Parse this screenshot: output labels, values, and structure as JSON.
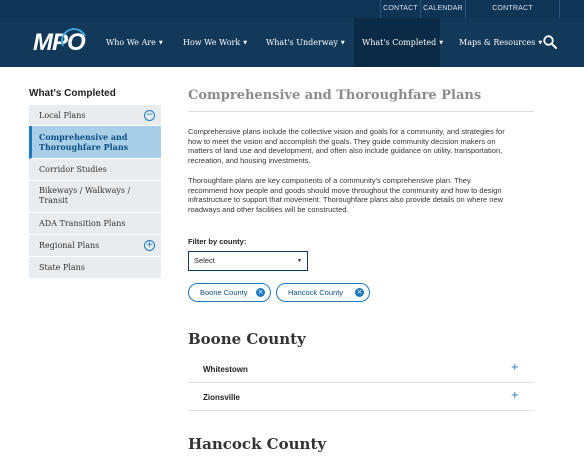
{
  "utility_nav": {
    "contact": "CONTACT",
    "calendar": "CALENDAR",
    "contract_opportunities": "CONTRACT OPPORTUNITIES"
  },
  "logo": {
    "text": "MPO"
  },
  "main_nav": {
    "items": [
      {
        "label": "Who We Are"
      },
      {
        "label": "How We Work"
      },
      {
        "label": "What's Underway"
      },
      {
        "label": "What's Completed"
      },
      {
        "label": "Maps & Resources"
      }
    ],
    "caret": "▼",
    "search_icon": "search-icon"
  },
  "sidebar": {
    "title": "What's Completed",
    "items": [
      {
        "label": "Local Plans",
        "toggle": "−",
        "toggle_icon": "minus-circle-icon"
      },
      {
        "label": "Comprehensive and Thoroughfare Plans",
        "active": true
      },
      {
        "label": "Corridor Studies"
      },
      {
        "label": "Bikeways / Walkways / Transit"
      },
      {
        "label": "ADA Transition Plans"
      },
      {
        "label": "Regional Plans",
        "toggle": "+",
        "toggle_icon": "plus-circle-icon"
      },
      {
        "label": "State Plans"
      }
    ]
  },
  "main": {
    "title": "Comprehensive and Thoroughfare Plans",
    "paragraph1": "Comprehensive plans include the collective vision and goals for a community, and strategies for how to meet the vision and accomplish the goals. They guide community decision makers on matters of land use and development, and often also include guidance on utility, transportation, recreation, and housing investments.",
    "paragraph2": "Thoroughfare plans are key components of a community's comprehensive plan. They recommend how people and goods should move throughout the community and how to design infrastructure to support that movement. Thoroughfare plans also provide details on where new roadways and other facilities will be constructed.",
    "filter": {
      "label": "Filter by county:",
      "selected": "Select",
      "arrow": "▼"
    },
    "active_filters": [
      {
        "label": "Boone County",
        "remove": "×"
      },
      {
        "label": "Hancock County",
        "remove": "×"
      }
    ],
    "counties": [
      {
        "name": "Boone County",
        "items": [
          {
            "label": "Whitestown",
            "expand": "+"
          },
          {
            "label": "Zionsville",
            "expand": "+"
          }
        ]
      },
      {
        "name": "Hancock County"
      }
    ]
  },
  "colors": {
    "utility_bar": "#0f3556",
    "nav_bar": "#12385a",
    "nav_active": "#0a2a45",
    "accent": "#1b79c2",
    "sidebar_active_bg": "#a9cfe8",
    "sidebar_bg": "#e9ecef"
  }
}
